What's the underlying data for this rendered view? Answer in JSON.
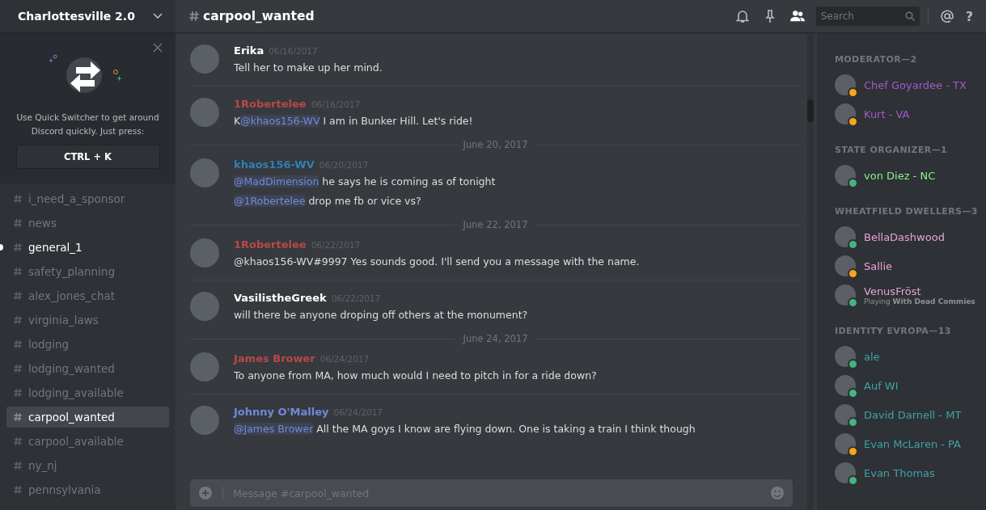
{
  "server": {
    "name": "Charlottesville 2.0"
  },
  "quick_switcher": {
    "text": "Use Quick Switcher to get around Discord quickly. Just press:",
    "shortcut": "CTRL + K"
  },
  "channels": [
    {
      "name": "i_need_a_sponsor",
      "selected": false,
      "unread": false
    },
    {
      "name": "news",
      "selected": false,
      "unread": false
    },
    {
      "name": "general_1",
      "selected": false,
      "unread": true
    },
    {
      "name": "safety_planning",
      "selected": false,
      "unread": false
    },
    {
      "name": "alex_jones_chat",
      "selected": false,
      "unread": false
    },
    {
      "name": "virginia_laws",
      "selected": false,
      "unread": false
    },
    {
      "name": "lodging",
      "selected": false,
      "unread": false
    },
    {
      "name": "lodging_wanted",
      "selected": false,
      "unread": false
    },
    {
      "name": "lodging_available",
      "selected": false,
      "unread": false
    },
    {
      "name": "carpool_wanted",
      "selected": true,
      "unread": false
    },
    {
      "name": "carpool_available",
      "selected": false,
      "unread": false
    },
    {
      "name": "ny_nj",
      "selected": false,
      "unread": false
    },
    {
      "name": "pennsylvania",
      "selected": false,
      "unread": false
    }
  ],
  "header": {
    "channel": "carpool_wanted",
    "search_placeholder": "Search",
    "help": "?"
  },
  "messages": [
    {
      "kind": "message",
      "author": "Erika",
      "color": "#ffffff",
      "time": "06/16/2017",
      "lines": [
        [
          {
            "kind": "text",
            "text": "Tell her to make up her mind."
          }
        ]
      ]
    },
    {
      "kind": "message",
      "author": "1Robertelee",
      "color": "#b8484a",
      "time": "06/16/2017",
      "lines": [
        [
          {
            "kind": "text",
            "text": "K"
          },
          {
            "kind": "mention",
            "text": "@khaos156-WV"
          },
          {
            "kind": "text",
            "text": "  I am in Bunker Hill. Let's ride!"
          }
        ]
      ]
    },
    {
      "kind": "divider",
      "text": "June 20, 2017"
    },
    {
      "kind": "message",
      "author": "khaos156-WV",
      "color": "#2e7fb5",
      "time": "06/20/2017",
      "lines": [
        [
          {
            "kind": "mention",
            "text": "@MadDimension"
          },
          {
            "kind": "text",
            "text": "  he says he is coming as of tonight"
          }
        ],
        [
          {
            "kind": "mention",
            "text": "@1Robertelee"
          },
          {
            "kind": "text",
            "text": " drop me fb or vice vs?"
          }
        ]
      ]
    },
    {
      "kind": "divider",
      "text": "June 22, 2017"
    },
    {
      "kind": "message",
      "author": "1Robertelee",
      "color": "#b8484a",
      "time": "06/22/2017",
      "lines": [
        [
          {
            "kind": "text",
            "text": "@khaos156-WV#9997  Yes sounds good. I'll send you a message with the name."
          }
        ]
      ]
    },
    {
      "kind": "message",
      "author": "VasilistheGreek",
      "color": "#ffffff",
      "time": "06/22/2017",
      "lines": [
        [
          {
            "kind": "text",
            "text": "will there be anyone droping off others at the monument?"
          }
        ]
      ]
    },
    {
      "kind": "divider",
      "text": "June 24, 2017"
    },
    {
      "kind": "message",
      "author": "James Brower",
      "color": "#b8484a",
      "time": "06/24/2017",
      "lines": [
        [
          {
            "kind": "text",
            "text": "To anyone from MA, how much would I need to pitch in for a ride down?"
          }
        ]
      ]
    },
    {
      "kind": "message",
      "author": "Johnny O'Malley",
      "color": "#7289da",
      "time": "06/24/2017",
      "lines": [
        [
          {
            "kind": "mention",
            "text": "@James Brower"
          },
          {
            "kind": "text",
            "text": "  All the MA goys I know are flying down. One is taking a train I think though"
          }
        ]
      ]
    }
  ],
  "composer": {
    "placeholder": "Message #carpool_wanted"
  },
  "member_groups": [
    {
      "name": "MODERATOR—2",
      "members": [
        {
          "name": "Chef Goyardee - TX",
          "color": "#a25bc8",
          "idle": true
        },
        {
          "name": "Kurt - VA",
          "color": "#a25bc8",
          "idle": true
        }
      ]
    },
    {
      "name": "STATE ORGANIZER—1",
      "members": [
        {
          "name": "von Diez - NC",
          "color": "#8ef08c",
          "idle": false
        }
      ]
    },
    {
      "name": "WHEATFIELD DWELLERS—3",
      "members": [
        {
          "name": "BellaDashwood",
          "color": "#e7a2d6",
          "idle": false
        },
        {
          "name": "Sallie",
          "color": "#e7a2d6",
          "idle": true
        },
        {
          "name": "VenusFröst",
          "color": "#e7a2d6",
          "idle": false,
          "activity": "Playing **With Dead Commies**"
        }
      ]
    },
    {
      "name": "IDENTITY EVROPA—13",
      "members": [
        {
          "name": "ale",
          "color": "#3fa3a8",
          "idle": false
        },
        {
          "name": "Auf WI",
          "color": "#3fa3a8",
          "idle": false
        },
        {
          "name": "David Darnell - MT",
          "color": "#3fa3a8",
          "idle": false
        },
        {
          "name": "Evan McLaren - PA",
          "color": "#3fa3a8",
          "idle": true
        },
        {
          "name": "Evan Thomas",
          "color": "#3fa3a8",
          "idle": false
        }
      ]
    }
  ]
}
